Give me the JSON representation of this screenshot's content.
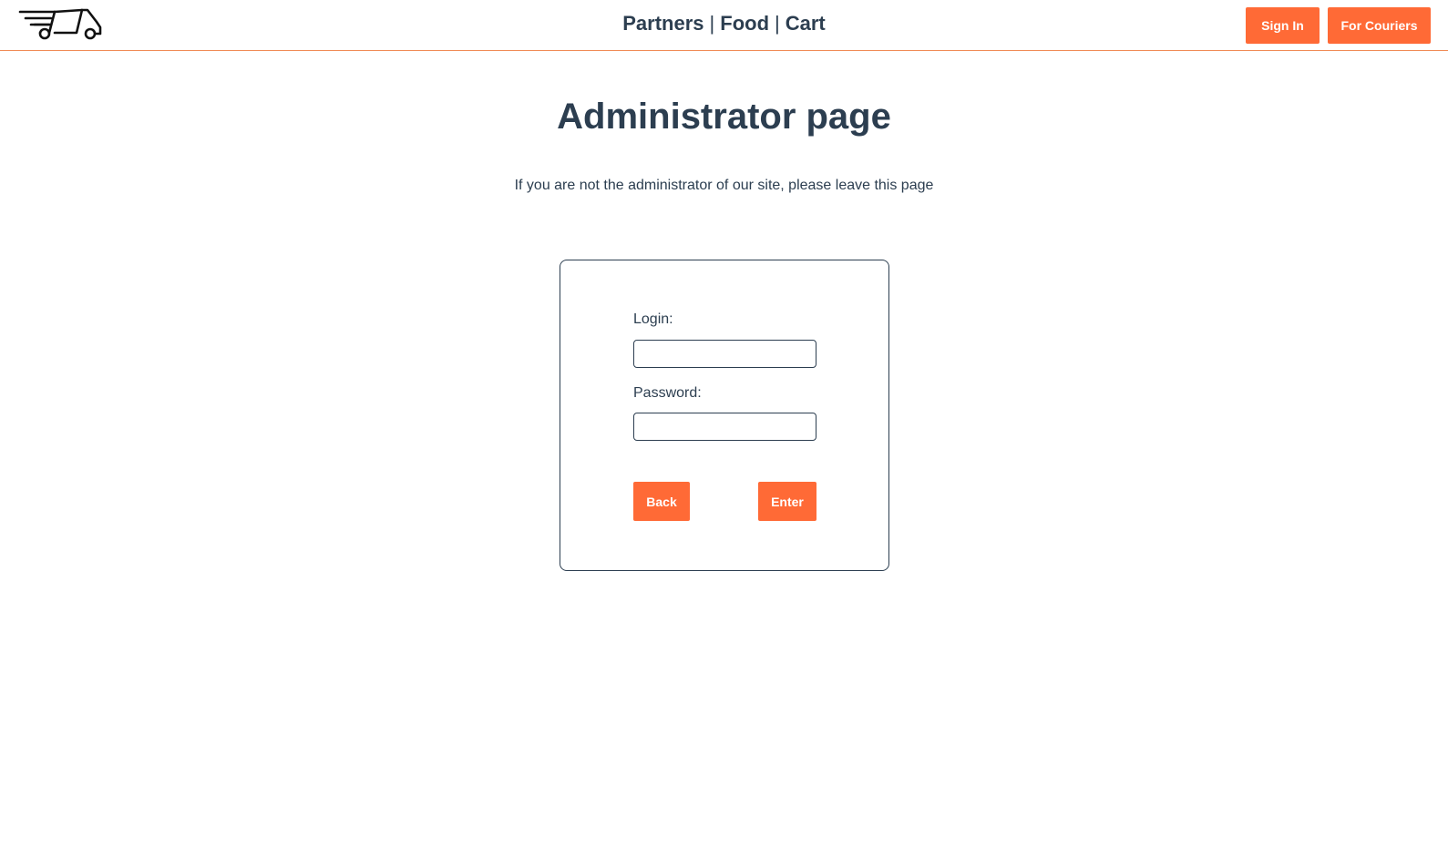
{
  "header": {
    "logo_icon": "delivery-truck-icon",
    "nav": [
      {
        "label": "Partners"
      },
      {
        "label": "Food"
      },
      {
        "label": "Cart"
      }
    ],
    "separator": "|",
    "sign_in_label": "Sign In",
    "couriers_label": "For Couriers"
  },
  "main": {
    "title": "Administrator page",
    "notice": "If you are not the administrator of our site, please leave this page"
  },
  "form": {
    "login_label": "Login:",
    "login_value": "",
    "password_label": "Password:",
    "password_value": "",
    "back_label": "Back",
    "enter_label": "Enter"
  },
  "colors": {
    "accent": "#ff6a36",
    "text": "#2c3e50",
    "divider": "#f08a55"
  }
}
